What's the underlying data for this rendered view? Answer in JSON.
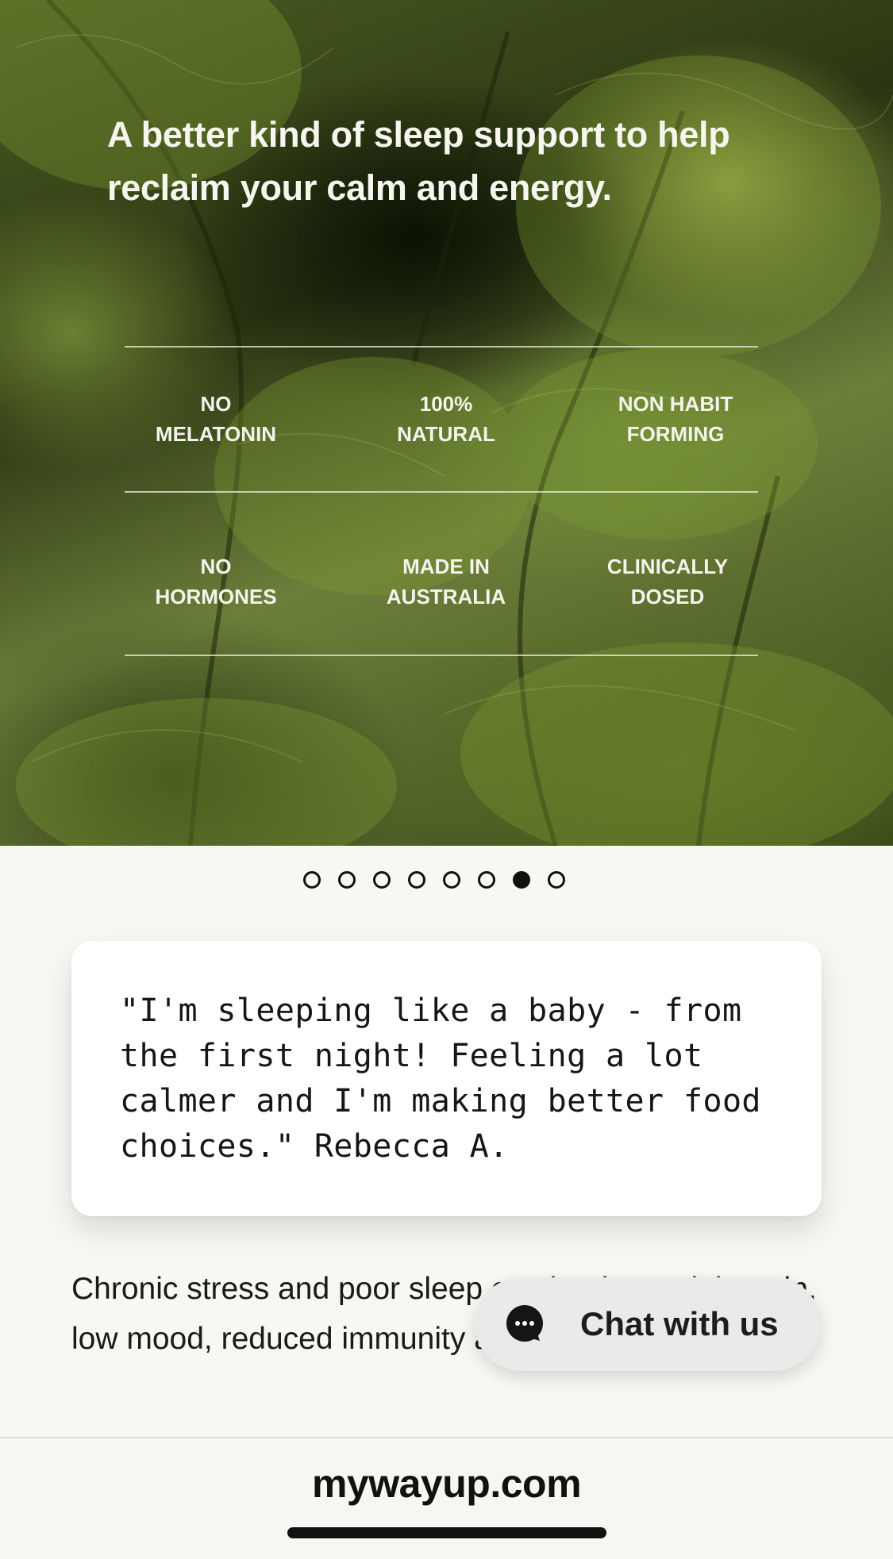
{
  "hero": {
    "headline": "A better kind of sleep support to help reclaim your calm and energy.",
    "features": [
      {
        "line1": "NO",
        "line2": "MELATONIN"
      },
      {
        "line1": "100%",
        "line2": "NATURAL"
      },
      {
        "line1": "NON HABIT",
        "line2": "FORMING"
      },
      {
        "line1": "NO",
        "line2": "HORMONES"
      },
      {
        "line1": "MADE IN",
        "line2": "AUSTRALIA"
      },
      {
        "line1": "CLINICALLY",
        "line2": "DOSED"
      }
    ]
  },
  "carousel": {
    "total_slides": 8,
    "active_slide": 7
  },
  "testimonial": {
    "text": "\"I'm sleeping like a baby - from the first night! Feeling a lot calmer and I'm making better food choices.\" Rebecca A."
  },
  "body": {
    "text": "Chronic stress and poor sleep can lead to weight gain, low mood, reduced immunity and digestive troubles."
  },
  "chat": {
    "label": "Chat with us",
    "icon": "chat-bubble-icon"
  },
  "browser": {
    "url": "mywayup.com"
  },
  "colors": {
    "page_bg": "#f8f7f3",
    "card_bg": "#ffffff",
    "chat_bg": "#eaeaea",
    "text": "#161616"
  }
}
